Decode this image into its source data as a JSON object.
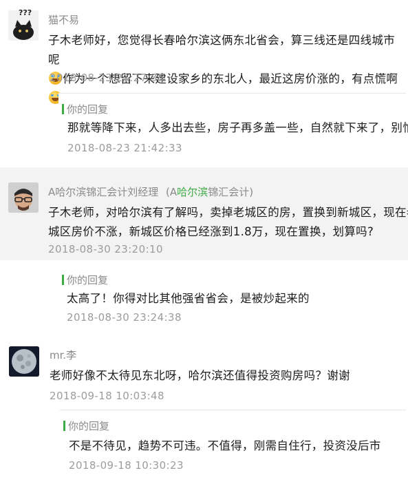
{
  "comments": [
    {
      "author": "猫不易",
      "text_line1": "子木老师好，您觉得长春哈尔滨这俩东北省会，算三线还是四线城市呢",
      "text_line2": "作为一个想留下来建设家乡的东北人，最近这房价涨的，有点慌啊",
      "time": "2018-08-23 21:27:35",
      "avatar_caption": "???",
      "reply": {
        "label": "你的回复",
        "text": "那就等降下来，人多出去些，房子再多盖一些，自然就下来了，别怕",
        "time": "2018-08-23 21:42:33"
      }
    },
    {
      "author_prefix": "A哈尔滨锦汇会计刘经理",
      "author_paren_open": "(A",
      "author_highlight": "哈尔滨",
      "author_paren_rest": "锦汇会计)",
      "text_line1": "子木老师，对哈尔滨有了解吗，卖掉老城区的房，置换到新城区，现在老",
      "text_line2": "城区房价不涨，新城区价格已经涨到1.8万，现在置换，划算吗?",
      "time": "2018-08-30 23:20:10",
      "reply": {
        "label": "你的回复",
        "text": "太高了！你得对比其他强省省会，是被炒起来的",
        "time": "2018-08-30 23:24:38"
      }
    },
    {
      "author": "mr.李",
      "text_line1": "老师好像不太待见东北呀，哈尔滨还值得投资购房吗？谢谢",
      "time": "2018-09-18 10:03:48",
      "reply": {
        "label": "你的回复",
        "text": "不是不待见，趋势不可违。不值得，刚需自住行，投资没后市",
        "time": "2018-09-18 10:30:23"
      }
    }
  ],
  "emoji_icon": "grinning-sweat-emoji"
}
